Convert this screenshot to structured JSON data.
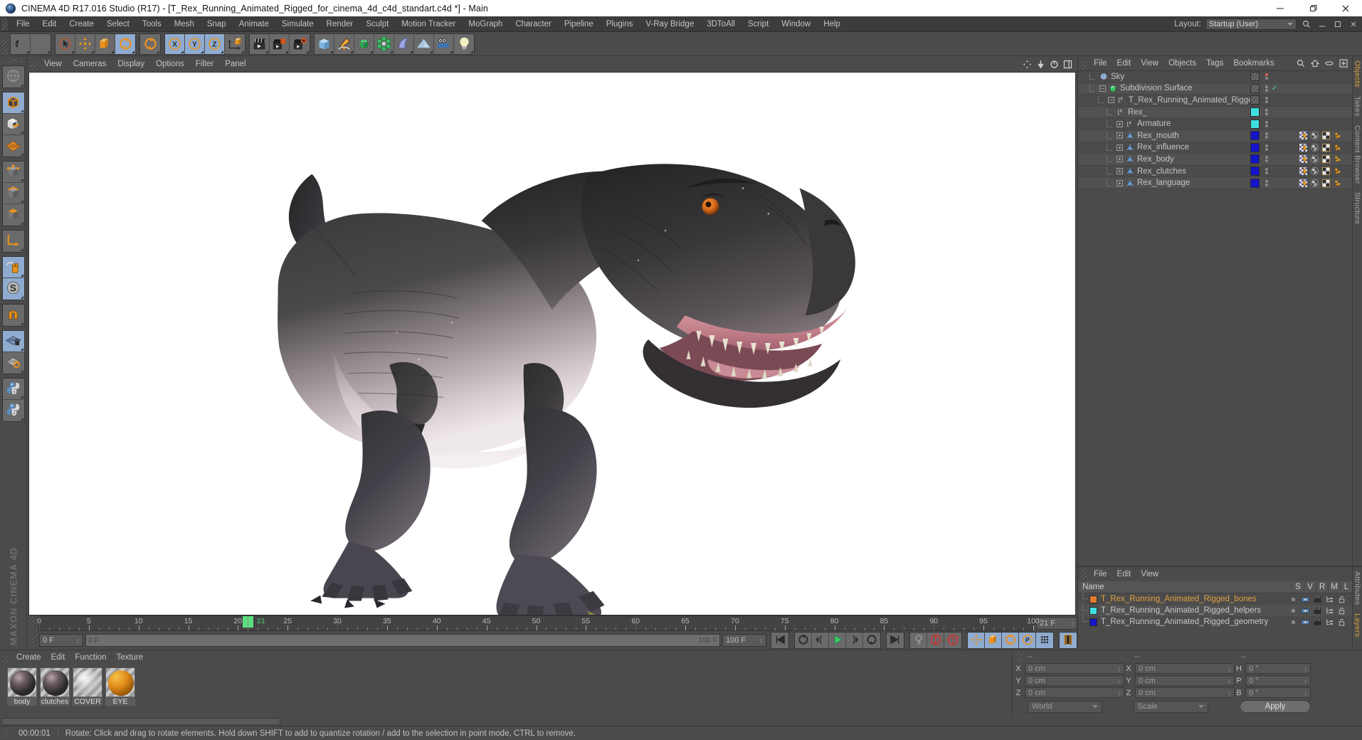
{
  "titlebar": {
    "title": "CINEMA 4D R17.016 Studio (R17) - [T_Rex_Running_Animated_Rigged_for_cinema_4d_c4d_standart.c4d *] - Main",
    "minimize": "—",
    "maximize": "❐",
    "close": "✕",
    "logo_icon": "c4d-logo-icon"
  },
  "menubar": {
    "items": [
      "File",
      "Edit",
      "Create",
      "Select",
      "Tools",
      "Mesh",
      "Snap",
      "Animate",
      "Simulate",
      "Render",
      "Sculpt",
      "Motion Tracker",
      "MoGraph",
      "Character",
      "Pipeline",
      "Plugins",
      "V-Ray Bridge",
      "3DToAll",
      "Script",
      "Window",
      "Help"
    ],
    "layout_label": "Layout:",
    "layout_value": "Startup (User)"
  },
  "toolbar": {
    "groups": [
      {
        "name": "undo-redo",
        "buttons": [
          {
            "name": "undo-button",
            "icon": "undo-arrow-icon",
            "selected": false,
            "dark": true
          },
          {
            "name": "redo-button",
            "icon": "redo-arrow-icon",
            "selected": false,
            "dark": true
          }
        ]
      },
      {
        "name": "transform-tools",
        "buttons": [
          {
            "name": "live-selection-tool",
            "icon": "cursor-circle-icon",
            "selected": false,
            "dark": true
          },
          {
            "name": "move-tool",
            "icon": "move-cross-icon",
            "selected": false,
            "dark": true
          },
          {
            "name": "scale-tool",
            "icon": "scale-box-icon",
            "selected": false,
            "dark": true
          },
          {
            "name": "rotate-tool",
            "icon": "rotate-circle-icon",
            "selected": true,
            "dark": false
          }
        ]
      },
      {
        "name": "rotate-alt",
        "buttons": [
          {
            "name": "rotate-tool-alt",
            "icon": "rotate-circle-icon",
            "selected": false,
            "dark": true
          }
        ]
      },
      {
        "name": "axis-locks",
        "buttons": [
          {
            "name": "x-axis-lock",
            "icon": "x-axis-icon",
            "selected": true,
            "dark": false
          },
          {
            "name": "y-axis-lock",
            "icon": "y-axis-icon",
            "selected": true,
            "dark": false
          },
          {
            "name": "z-axis-lock",
            "icon": "z-axis-icon",
            "selected": true,
            "dark": false
          },
          {
            "name": "world-object-coordinate-toggle",
            "icon": "world-axis-cube-icon",
            "selected": false,
            "dark": true
          }
        ]
      },
      {
        "name": "render-tools",
        "buttons": [
          {
            "name": "render-view-button",
            "icon": "clapper-icon",
            "selected": false,
            "dark": true
          },
          {
            "name": "render-to-picture-viewer-button",
            "icon": "clapper-picture-icon",
            "selected": false,
            "dark": true
          },
          {
            "name": "render-settings-button",
            "icon": "clapper-gear-icon",
            "selected": false,
            "dark": true
          }
        ]
      },
      {
        "name": "object-creation",
        "buttons": [
          {
            "name": "add-cube-button",
            "icon": "cube-icon",
            "selected": false,
            "dark": true
          },
          {
            "name": "add-spline-button",
            "icon": "pen-spline-icon",
            "selected": false,
            "dark": true
          },
          {
            "name": "add-generator-button",
            "icon": "green-cube-nurbs-icon",
            "selected": false,
            "dark": true
          },
          {
            "name": "add-deformer-button",
            "icon": "green-flower-deformer-icon",
            "selected": false,
            "dark": true
          },
          {
            "name": "add-environment-button",
            "icon": "blue-wave-icon",
            "selected": false,
            "dark": true
          },
          {
            "name": "add-floor-button",
            "icon": "grid-floor-icon",
            "selected": false,
            "dark": true
          },
          {
            "name": "add-camera-button",
            "icon": "camera-icon",
            "selected": false,
            "dark": true
          },
          {
            "name": "add-light-button",
            "icon": "light-bulb-icon",
            "selected": false,
            "dark": true
          }
        ]
      }
    ]
  },
  "left_toolbar": {
    "groups": [
      {
        "buttons": [
          {
            "name": "viewport-globe-tool",
            "icon": "globe-wire-icon",
            "selected": false
          }
        ]
      },
      {
        "buttons": [
          {
            "name": "model-mode-button",
            "icon": "orange-outline-cube-icon",
            "selected": true
          },
          {
            "name": "texture-mode-button",
            "icon": "checker-cube-icon",
            "selected": false
          },
          {
            "name": "workplane-mode-button",
            "icon": "orange-grid-plane-icon",
            "selected": false
          }
        ]
      },
      {
        "buttons": [
          {
            "name": "points-mode-button",
            "icon": "cube-points-icon",
            "selected": false
          },
          {
            "name": "edges-mode-button",
            "icon": "cube-edges-icon",
            "selected": false
          },
          {
            "name": "polygons-mode-button",
            "icon": "cube-polygons-icon",
            "selected": false
          }
        ]
      },
      {
        "buttons": [
          {
            "name": "axis-modify-button",
            "icon": "orange-axis-icon",
            "selected": false
          }
        ]
      },
      {
        "buttons": [
          {
            "name": "enable-snapping-button",
            "icon": "mouse-icon",
            "selected": true
          },
          {
            "name": "soft-selection-button",
            "icon": "s-circle-icon",
            "selected": true
          }
        ]
      },
      {
        "buttons": [
          {
            "name": "magnet-tool-button",
            "icon": "magnet-icon",
            "selected": false
          }
        ]
      },
      {
        "buttons": [
          {
            "name": "workplane-lock-button",
            "icon": "grid-lock-icon",
            "selected": true
          },
          {
            "name": "planar-workplane-button",
            "icon": "grid-rotate-icon",
            "selected": false
          }
        ]
      },
      {
        "buttons": [
          {
            "name": "python-script-button",
            "icon": "python-icon",
            "selected": false
          },
          {
            "name": "python-generator-button",
            "icon": "python-icon",
            "selected": false
          }
        ]
      }
    ],
    "brand": "MAXON CINEMA 4D"
  },
  "viewport": {
    "menu": [
      "View",
      "Cameras",
      "Display",
      "Options",
      "Filter",
      "Panel"
    ],
    "icons": [
      "pan-icon",
      "zoom-icon",
      "rotate-view-icon",
      "maximize-view-icon"
    ],
    "content_label": "t-rex-3d-model"
  },
  "timeline": {
    "ticks": [
      0,
      5,
      10,
      15,
      20,
      25,
      30,
      35,
      40,
      45,
      50,
      55,
      60,
      65,
      70,
      75,
      80,
      85,
      90,
      95,
      100
    ],
    "current_frame_label": "21",
    "current_frame": 21,
    "min": 0,
    "max": 100,
    "frame_end_field": "21 F",
    "start_field": "0 F",
    "range_start": "0 F",
    "range_end": "100 F",
    "doc_length": "100 F"
  },
  "playback": {
    "buttons": [
      {
        "name": "go-to-start-button",
        "icon": "skip-start-icon",
        "selected": false
      },
      {
        "name": "previous-keyframe-button",
        "icon": "prev-key-icon",
        "selected": false
      },
      {
        "name": "previous-frame-button",
        "icon": "step-back-icon",
        "selected": false
      },
      {
        "name": "play-button",
        "icon": "play-icon",
        "selected": false
      },
      {
        "name": "next-frame-button",
        "icon": "step-forward-icon",
        "selected": false
      },
      {
        "name": "next-keyframe-button",
        "icon": "next-key-icon",
        "selected": false
      },
      {
        "name": "go-to-end-button",
        "icon": "skip-end-icon",
        "selected": false
      }
    ],
    "record_group": [
      {
        "name": "autokey-button",
        "icon": "key-icon",
        "selected": false
      },
      {
        "name": "record-active-objects-button",
        "icon": "record-red-icon",
        "selected": false
      },
      {
        "name": "record-question-button",
        "icon": "record-question-icon",
        "selected": false
      }
    ],
    "param_group": [
      {
        "name": "position-key-button",
        "icon": "move-cross-icon",
        "selected": true
      },
      {
        "name": "scale-key-button",
        "icon": "scale-box-icon",
        "selected": true
      },
      {
        "name": "rotation-key-button",
        "icon": "rotate-circle-icon",
        "selected": true
      },
      {
        "name": "parameter-key-button",
        "icon": "p-circle-icon",
        "selected": true
      },
      {
        "name": "point-level-animation-button",
        "icon": "dots-grid-icon",
        "selected": true
      }
    ],
    "extra_group": [
      {
        "name": "timeline-toggle-button",
        "icon": "filmstrip-icon",
        "selected": true
      }
    ]
  },
  "object_manager": {
    "menu": [
      "File",
      "Edit",
      "View",
      "Objects",
      "Tags",
      "Bookmarks"
    ],
    "head_icons": [
      "search-icon",
      "home-icon",
      "eye-icon",
      "expand-icon"
    ],
    "rows": [
      {
        "name": "Sky",
        "indent": 1,
        "expander": "none",
        "icon": "sky-sphere-icon",
        "swatch": null,
        "dot_top": "red",
        "tags": [],
        "check": false
      },
      {
        "name": "Subdivision Surface",
        "indent": 1,
        "expander": "minus",
        "icon": "subdivision-surface-icon",
        "swatch": null,
        "dot_top": "grey",
        "tags": [],
        "check": true
      },
      {
        "name": "T_Rex_Running_Animated_Rigged",
        "indent": 2,
        "expander": "minus",
        "icon": "null-object-icon",
        "swatch": null,
        "dot_top": "grey",
        "tags": [],
        "check": false
      },
      {
        "name": "Rex_",
        "indent": 3,
        "expander": "none",
        "icon": "null-object-icon",
        "swatch": "#3fe0e0",
        "dot_top": "grey",
        "tags": [],
        "check": false
      },
      {
        "name": "Armature",
        "indent": 3,
        "expander": "plus",
        "icon": "null-object-icon",
        "swatch": "#3fe0e0",
        "dot_top": "grey",
        "tags": [],
        "check": false
      },
      {
        "name": "Rex_mouth",
        "indent": 3,
        "expander": "plus",
        "icon": "polygon-object-icon",
        "swatch": "#1414c8",
        "dot_top": "grey",
        "tags": [
          "weight-tag",
          "material-tag",
          "uvw-tag",
          "point-tag"
        ],
        "check": false
      },
      {
        "name": "Rex_influence",
        "indent": 3,
        "expander": "plus",
        "icon": "polygon-object-icon",
        "swatch": "#1414c8",
        "dot_top": "grey",
        "tags": [
          "weight-tag",
          "material-tag",
          "uvw-tag",
          "point-tag"
        ],
        "check": false
      },
      {
        "name": "Rex_body",
        "indent": 3,
        "expander": "plus",
        "icon": "polygon-object-icon",
        "swatch": "#1414c8",
        "dot_top": "grey",
        "tags": [
          "weight-tag",
          "material-tag",
          "uvw-tag",
          "point-tag"
        ],
        "check": false
      },
      {
        "name": "Rex_clutches",
        "indent": 3,
        "expander": "plus",
        "icon": "polygon-object-icon",
        "swatch": "#1414c8",
        "dot_top": "grey",
        "tags": [
          "weight-tag",
          "material-tag",
          "uvw-tag",
          "point-tag"
        ],
        "check": false
      },
      {
        "name": "Rex_language",
        "indent": 3,
        "expander": "plus",
        "icon": "polygon-object-icon",
        "swatch": "#1414c8",
        "dot_top": "grey",
        "tags": [
          "weight-tag",
          "material-tag",
          "uvw-tag",
          "point-tag"
        ],
        "check": false
      }
    ],
    "side_tabs": [
      "Objects",
      "Takes",
      "Content Browser",
      "Structure"
    ]
  },
  "layer_manager": {
    "menu": [
      "File",
      "Edit",
      "View"
    ],
    "columns": [
      "Name",
      "S",
      "V",
      "R",
      "M",
      "L"
    ],
    "rows": [
      {
        "name": "T_Rex_Running_Animated_Rigged_bones",
        "color": "#e07a30",
        "text_color": "#e0a040"
      },
      {
        "name": "T_Rex_Running_Animated_Rigged_helpers",
        "color": "#3fe0e0",
        "text_color": "#c8c8c8"
      },
      {
        "name": "T_Rex_Running_Animated_Rigged_geometry",
        "color": "#1414c8",
        "text_color": "#c8c8c8"
      }
    ],
    "side_tabs": [
      "Attributes",
      "Layers"
    ]
  },
  "material_manager": {
    "menu": [
      "Create",
      "Edit",
      "Function",
      "Texture"
    ],
    "materials": [
      {
        "name": "body",
        "preview": "dark-skin-sphere"
      },
      {
        "name": "clutches",
        "preview": "dark-skin-sphere"
      },
      {
        "name": "COVER",
        "preview": "transparent-glass-sphere"
      },
      {
        "name": "EYE",
        "preview": "orange-eye-sphere"
      }
    ]
  },
  "coordinates": {
    "headers": [
      "--",
      "--",
      "--"
    ],
    "position": {
      "label_x": "X",
      "label_y": "Y",
      "label_z": "Z",
      "x": "0 cm",
      "y": "0 cm",
      "z": "0 cm"
    },
    "size": {
      "label_x": "X",
      "label_y": "Y",
      "label_z": "Z",
      "x": "0 cm",
      "y": "0 cm",
      "z": "0 cm"
    },
    "rotation": {
      "label_h": "H",
      "label_p": "P",
      "label_b": "B",
      "h": "0 °",
      "p": "0 °",
      "b": "0 °"
    },
    "coord_system": "World",
    "size_mode": "Scale",
    "apply_label": "Apply"
  },
  "statusbar": {
    "time": "00:00:01",
    "message": "Rotate: Click and drag to rotate elements. Hold down SHIFT to add to quantize rotation / add to the selection in point mode, CTRL to remove."
  },
  "colors": {
    "accent_orange": "#e08a2a",
    "selected_blue": "#8fabd0",
    "panel_bg": "#4b4b4b",
    "viewport_bg": "#ffffff",
    "green_marker": "#5ddf7f",
    "record_red": "#d03030"
  }
}
